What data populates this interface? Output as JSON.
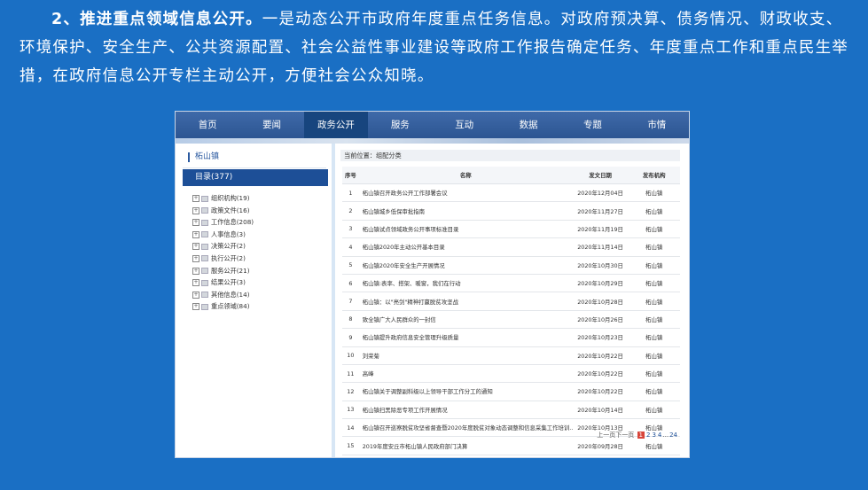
{
  "intro": {
    "lead": "2、推进重点领域信息公开。",
    "body": "一是动态公开市政府年度重点任务信息。对政府预决算、债务情况、财政收支、环境保护、安全生产、公共资源配置、社会公益性事业建设等政府工作报告确定任务、年度重点工作和重点民生举措，在政府信息公开专栏主动公开，方便社会公众知晓。"
  },
  "nav": [
    "首页",
    "要闻",
    "政务公开",
    "服务",
    "互动",
    "数据",
    "专题",
    "市情"
  ],
  "nav_active": 2,
  "sidebar": {
    "town": "柘山镇",
    "catalog": "目录(377)",
    "tree": [
      "组织机构(19)",
      "政策文件(16)",
      "工作信息(208)",
      "人事信息(3)",
      "决策公开(2)",
      "执行公开(2)",
      "服务公开(21)",
      "结果公开(3)",
      "其他信息(14)",
      "重点领域(84)"
    ]
  },
  "main": {
    "crumb": "当前位置：组配分类",
    "headers": {
      "num": "序号",
      "title": "名称",
      "date": "发文日期",
      "org": "发布机构"
    },
    "rows": [
      {
        "num": "1",
        "title": "柘山镇召开政务公开工作部署会议",
        "date": "2020年12月04日",
        "org": "柘山镇"
      },
      {
        "num": "2",
        "title": "柘山镇城乡低保审批指南",
        "date": "2020年11月27日",
        "org": "柘山镇"
      },
      {
        "num": "3",
        "title": "柘山镇试点领域政务公开事项标准目录",
        "date": "2020年11月19日",
        "org": "柘山镇"
      },
      {
        "num": "4",
        "title": "柘山镇2020年主动公开基本目录",
        "date": "2020年11月14日",
        "org": "柘山镇"
      },
      {
        "num": "5",
        "title": "柘山镇2020年安全生产开展情况",
        "date": "2020年10月30日",
        "org": "柘山镇"
      },
      {
        "num": "6",
        "title": "柘山镇:表率、搭架、暖窗，我们在行动",
        "date": "2020年10月29日",
        "org": "柘山镇"
      },
      {
        "num": "7",
        "title": "柘山镇：以\"亮剑\"精神打赢脱贫攻坚战",
        "date": "2020年10月28日",
        "org": "柘山镇"
      },
      {
        "num": "8",
        "title": "致全镇广大人民群众的一封信",
        "date": "2020年10月26日",
        "org": "柘山镇"
      },
      {
        "num": "9",
        "title": "柘山镇提升政府信息安全管理升级质量",
        "date": "2020年10月23日",
        "org": "柘山镇"
      },
      {
        "num": "10",
        "title": "刘荣菊",
        "date": "2020年10月22日",
        "org": "柘山镇"
      },
      {
        "num": "11",
        "title": "高峰",
        "date": "2020年10月22日",
        "org": "柘山镇"
      },
      {
        "num": "12",
        "title": "柘山镇关于调整副科级以上领导干部工作分工的通知",
        "date": "2020年10月22日",
        "org": "柘山镇"
      },
      {
        "num": "13",
        "title": "柘山镇扫黑除恶专项工作开展情况",
        "date": "2020年10月14日",
        "org": "柘山镇"
      },
      {
        "num": "14",
        "title": "柘山镇召开巡察脱贫攻坚省督查暨2020年度脱贫对象动态调整和信息采集工作培训...",
        "date": "2020年10月13日",
        "org": "柘山镇"
      },
      {
        "num": "15",
        "title": "2019年度安丘市柘山镇人民政府部门决算",
        "date": "2020年09月28日",
        "org": "柘山镇"
      }
    ]
  },
  "pager": {
    "prev": "上一页",
    "next": "下一页",
    "pages": [
      "1",
      "2",
      "3",
      "4"
    ],
    "ellipsis": "...",
    "last": "24",
    "current": "1"
  },
  "colors": {
    "background": "#1a6fc4",
    "nav": "#2c5592",
    "nav_active": "#17457e",
    "catalog": "#1d4f97",
    "current_page": "#d8453a"
  }
}
